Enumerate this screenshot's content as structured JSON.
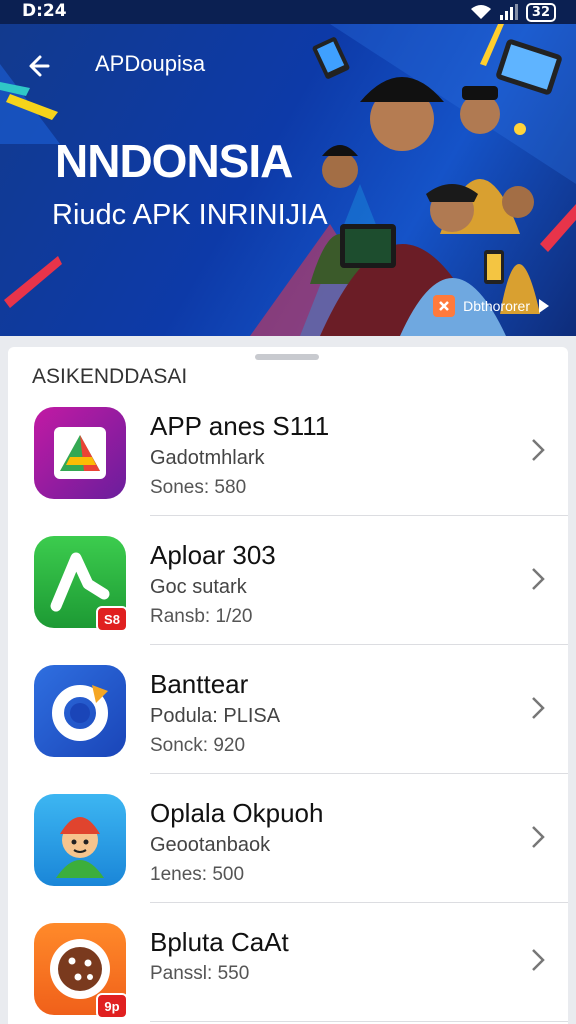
{
  "status": {
    "time": "D:24",
    "battery": "32"
  },
  "banner": {
    "app_title": "APDoupisa",
    "headline": "NNDONSIA",
    "subheadline": "Riudc APK INRINIJIA",
    "cta_label": "Dbthororer"
  },
  "section": {
    "title": "ASIKENDDASAI"
  },
  "apps": [
    {
      "name": "APP anes S111",
      "subtitle": "Gadotmhlark",
      "meta": "Sones: 580",
      "icon": "play-triangle-icon",
      "badge": ""
    },
    {
      "name": "Aploar 303",
      "subtitle": "Goc sutark",
      "meta": "Ransb: 1/20",
      "icon": "check-arrow-icon",
      "badge": "S8"
    },
    {
      "name": "Banttear",
      "subtitle": "Podula: PLISA",
      "meta": "Sonck: 920",
      "icon": "refresh-circle-icon",
      "badge": ""
    },
    {
      "name": "Oplala Okpuoh",
      "subtitle": "Geootanbaok",
      "meta": "1enes: 500",
      "icon": "cartoon-character-icon",
      "badge": ""
    },
    {
      "name": "Bpluta CaAt",
      "subtitle": "",
      "meta": "Panssl: 550",
      "icon": "cookie-icon",
      "badge": "9p"
    }
  ],
  "colors": {
    "banner": "#0d3aa8",
    "status_bar": "#0b2052",
    "badge": "#e02020"
  }
}
